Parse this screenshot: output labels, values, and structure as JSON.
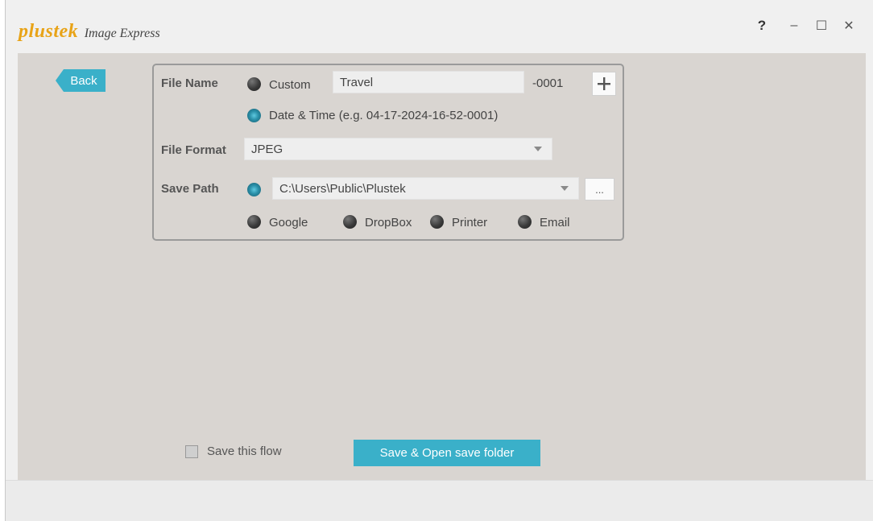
{
  "app": {
    "brand": "plustek",
    "product": "Image Express"
  },
  "window_controls": {
    "help": "?",
    "minimize": "–",
    "maximize": "☐",
    "close": "✕"
  },
  "back_label": "Back",
  "file_name": {
    "label": "File Name",
    "custom_label": "Custom",
    "custom_value": "Travel",
    "suffix": "-0001",
    "datetime_label": "Date & Time (e.g. 04-17-2024-16-52-0001)",
    "selected": "datetime"
  },
  "file_format": {
    "label": "File Format",
    "value": "JPEG"
  },
  "save_path": {
    "label": "Save Path",
    "value": "C:\\Users\\Public\\Plustek",
    "browse_label": "...",
    "options": [
      "Google",
      "DropBox",
      "Printer",
      "Email"
    ],
    "selected": "local"
  },
  "footer": {
    "save_flow_label": "Save this flow",
    "save_flow_checked": false,
    "save_open_label": "Save & Open save folder"
  },
  "colors": {
    "accent": "#3ab0c9",
    "brand_orange": "#e8a317",
    "content_bg": "#d9d5d1"
  }
}
